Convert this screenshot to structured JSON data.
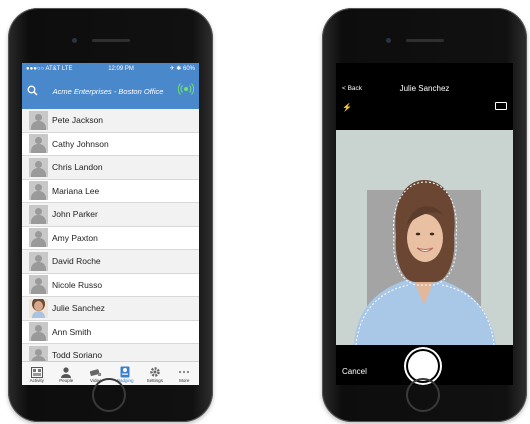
{
  "left_phone": {
    "status": {
      "carrier": "●●●○○ AT&T  LTE",
      "time": "12:09 PM",
      "battery": "✈ ✱ 60%"
    },
    "nav": {
      "title": "Acme Enterprises - Boston Office"
    },
    "contacts": [
      {
        "name": "Pete Jackson"
      },
      {
        "name": "Cathy Johnson"
      },
      {
        "name": "Chris Landon"
      },
      {
        "name": "Mariana Lee"
      },
      {
        "name": "John Parker"
      },
      {
        "name": "Amy Paxton"
      },
      {
        "name": "David Roche"
      },
      {
        "name": "Nicole Russo"
      },
      {
        "name": "Julie Sanchez"
      },
      {
        "name": "Ann Smith"
      },
      {
        "name": "Todd Soriano"
      }
    ],
    "tabs": [
      {
        "label": "Activity"
      },
      {
        "label": "People"
      },
      {
        "label": "Video"
      },
      {
        "label": "Badging"
      },
      {
        "label": "Settings"
      },
      {
        "label": "More"
      }
    ]
  },
  "right_phone": {
    "back_label": "< Back",
    "title": "Julie Sanchez",
    "cancel_label": "Cancel"
  },
  "colors": {
    "accent": "#4a88cc",
    "tab_active": "#3b7fd1"
  },
  "icons": [
    "search-icon",
    "nfc-icon",
    "activity-icon",
    "people-icon",
    "video-icon",
    "badging-icon",
    "settings-icon",
    "more-icon",
    "flash-icon",
    "camera-switch-icon"
  ]
}
